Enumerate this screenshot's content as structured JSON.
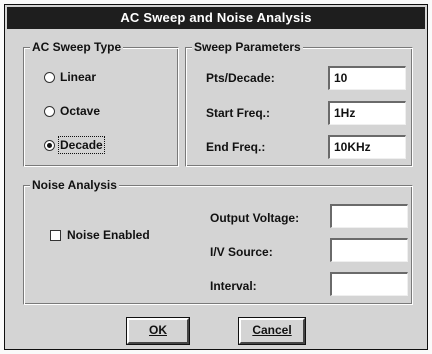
{
  "dialog": {
    "title": "AC Sweep and Noise Analysis"
  },
  "ac_sweep_type": {
    "legend": "AC Sweep Type",
    "options": [
      {
        "label": "Linear",
        "selected": false
      },
      {
        "label": "Octave",
        "selected": false
      },
      {
        "label": "Decade",
        "selected": true
      }
    ]
  },
  "sweep_parameters": {
    "legend": "Sweep Parameters",
    "pts_decade": {
      "label": "Pts/Decade:",
      "value": "10"
    },
    "start_freq": {
      "label": "Start Freq.:",
      "value": "1Hz"
    },
    "end_freq": {
      "label": "End Freq.:",
      "value": "10KHz"
    }
  },
  "noise_analysis": {
    "legend": "Noise Analysis",
    "noise_enabled": {
      "label": "Noise Enabled",
      "checked": false
    },
    "output_voltage": {
      "label": "Output Voltage:",
      "value": ""
    },
    "iv_source": {
      "label": "I/V Source:",
      "value": ""
    },
    "interval": {
      "label": "Interval:",
      "value": ""
    }
  },
  "buttons": {
    "ok": {
      "label": "OK"
    },
    "cancel": {
      "label": "Cancel"
    }
  }
}
